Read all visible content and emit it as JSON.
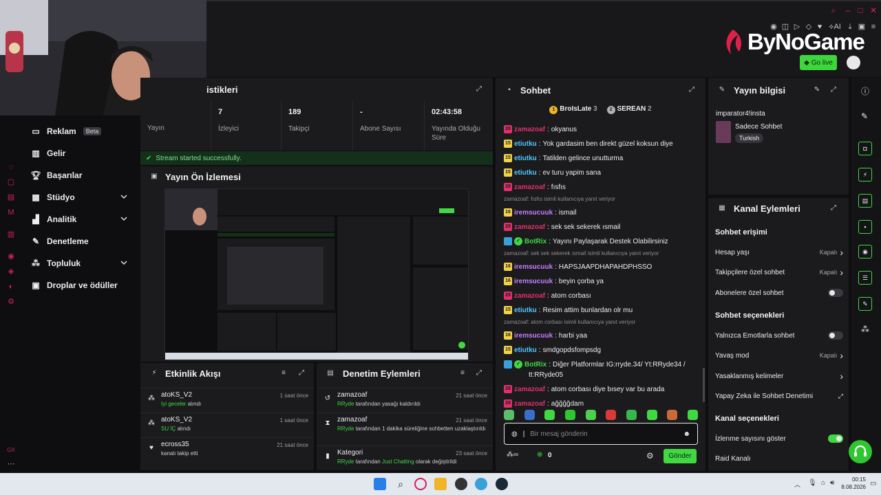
{
  "browser": {
    "brand": "ByNoGame",
    "go_live": "Go live",
    "tool_ai": "AI"
  },
  "sidebar": {
    "items": [
      {
        "label": "Reklam",
        "badge": "Beta"
      },
      {
        "label": "Gelir"
      },
      {
        "label": "Başarılar"
      },
      {
        "label": "Stüdyo"
      },
      {
        "label": "Analitik"
      },
      {
        "label": "Denetleme"
      },
      {
        "label": "Topluluk"
      },
      {
        "label": "Droplar ve ödüller"
      }
    ],
    "rail_text": "GX"
  },
  "stats": {
    "title_fragment": "istikleri",
    "cells": [
      {
        "value": "",
        "label": "Yayın"
      },
      {
        "value": "7",
        "label": "İzleyici"
      },
      {
        "value": "189",
        "label": "Takipçi"
      },
      {
        "value": "-",
        "label": "Abone Sayısı"
      },
      {
        "value": "02:43:58",
        "label": "Yayında Olduğu Süre"
      }
    ],
    "success_message": "Stream started successfully."
  },
  "preview": {
    "title": "Yayın Ön İzlemesi"
  },
  "events": {
    "title": "Etkinlik Akışı",
    "rows": [
      {
        "user": "atoKS_V2",
        "item": "Iyi geceler",
        "suffix": "alındı",
        "time": "1 saat önce"
      },
      {
        "user": "atoKS_V2",
        "item": "SU İÇ",
        "suffix": "alındı",
        "time": "1 saat önce"
      },
      {
        "user": "ecross35",
        "item": "",
        "suffix": "kanalı takip etti",
        "time": "21 saat önce"
      }
    ]
  },
  "moderation": {
    "title": "Denetim Eylemleri",
    "rows": [
      {
        "title": "zamazoaf",
        "by": "RRyde",
        "text": "tarafından yasağı kaldırıldı",
        "time": "21 saat önce"
      },
      {
        "title": "zamazoaf",
        "by": "RRyde",
        "text": "tarafından 1 dakika süreliğine sohbetten uzaklaştırıldı",
        "time": "21 saat önce"
      },
      {
        "title": "Kategori",
        "by": "RRyde",
        "text": "tarafından",
        "highlight": "Just Chatting",
        "tail": "olarak değiştirildi",
        "time": "23 saat önce"
      }
    ]
  },
  "chat": {
    "title": "Sohbet",
    "top": [
      {
        "rank": "1",
        "name": "BroIsLate",
        "count": "3"
      },
      {
        "rank": "2",
        "name": "SEREAN",
        "count": "2"
      }
    ],
    "messages": [
      {
        "type": "msg",
        "lvl": "28",
        "user": "zamazoaf",
        "color": "#e0306a",
        "text": "okyanus"
      },
      {
        "type": "msg",
        "lvl": "15",
        "user": "etiutku",
        "color": "#4ec8ff",
        "text": "Yok gardasim ben direkt güzel koksun diye"
      },
      {
        "type": "msg",
        "lvl": "15",
        "user": "etiutku",
        "color": "#4ec8ff",
        "text": "Tatilden gelince unutturma"
      },
      {
        "type": "msg",
        "lvl": "15",
        "user": "etiutku",
        "color": "#4ec8ff",
        "text": "ev turu yapim sana"
      },
      {
        "type": "msg",
        "lvl": "28",
        "user": "zamazoaf",
        "color": "#e0306a",
        "text": "fısfıs"
      },
      {
        "type": "reply",
        "text": "zamazoaf: fısfıs isimli kullanıcıya yanıt veriyor"
      },
      {
        "type": "msg",
        "lvl": "16",
        "user": "iremsucuuk",
        "color": "#c77dff",
        "text": "ismail"
      },
      {
        "type": "msg",
        "lvl": "28",
        "user": "zamazoaf",
        "color": "#e0306a",
        "text": "sek sek sekerek ısmail"
      },
      {
        "type": "msg",
        "lvl": "B",
        "user": "BotRix",
        "color": "#41d843",
        "text": "Yayını Paylaşarak Destek Olabilirsiniz"
      },
      {
        "type": "reply",
        "text": "zamazoaf: sek sek sekerek ısmail isimli kullanıcıya yanıt veriyor"
      },
      {
        "type": "msg",
        "lvl": "16",
        "user": "iremsucuuk",
        "color": "#c77dff",
        "text": "HAPSJAAPDHAPAHDPHSSO"
      },
      {
        "type": "msg",
        "lvl": "16",
        "user": "iremsucuuk",
        "color": "#c77dff",
        "text": "beyin çorba ya"
      },
      {
        "type": "msg",
        "lvl": "28",
        "user": "zamazoaf",
        "color": "#e0306a",
        "text": "atom corbası"
      },
      {
        "type": "msg",
        "lvl": "15",
        "user": "etiutku",
        "color": "#4ec8ff",
        "text": "Resim attim bunlardan olr mu"
      },
      {
        "type": "reply",
        "text": "zamazoaf: atom corbası isimli kullanıcıya yanıt veriyor"
      },
      {
        "type": "msg",
        "lvl": "16",
        "user": "iremsucuuk",
        "color": "#c77dff",
        "text": "harbi yaa"
      },
      {
        "type": "msg",
        "lvl": "15",
        "user": "etiutku",
        "color": "#4ec8ff",
        "text": "smdgopdsfompsdg"
      },
      {
        "type": "msg2",
        "lvl": "B",
        "user": "BotRix",
        "color": "#41d843",
        "text": "Diğer Platformlar IG:rryde.34/ Yt:RRyde34 /",
        "text2": "tt:RRyde05"
      },
      {
        "type": "msg",
        "lvl": "28",
        "user": "zamazoaf",
        "color": "#e0306a",
        "text": "atom corbası diye bısey var bu arada"
      },
      {
        "type": "msg",
        "lvl": "28",
        "user": "zamazoaf",
        "color": "#e0306a",
        "text": "ağğğğdam"
      }
    ],
    "input_placeholder": "Bir mesaj gönderin",
    "points": "0",
    "send": "Gönder"
  },
  "info": {
    "title": "Yayın bilgisi",
    "stream_title": "imparator4!insta",
    "category": "Sadece Sohbet",
    "language": "Turkish"
  },
  "channel": {
    "title": "Kanal Eylemleri",
    "chat_access": "Sohbet erişimi",
    "access_rows": [
      {
        "label": "Hesap yaşı",
        "state": "Kapalı",
        "kind": "chev"
      },
      {
        "label": "Takipçilere özel sohbet",
        "state": "Kapalı",
        "kind": "chev"
      },
      {
        "label": "Abonelere özel sohbet",
        "state": "",
        "kind": "toggle-off"
      }
    ],
    "chat_options": "Sohbet seçenekleri",
    "option_rows": [
      {
        "label": "Yalnızca Emotlarla sohbet",
        "state": "",
        "kind": "toggle-off"
      },
      {
        "label": "Yavaş mod",
        "state": "Kapalı",
        "kind": "chev"
      },
      {
        "label": "Yasaklanmış kelimeler",
        "state": "",
        "kind": "chev"
      },
      {
        "label": "Yapay Zeka ile Sohbet Denetimi",
        "state": "",
        "kind": "ext"
      }
    ],
    "channel_options": "Kanal seçenekleri",
    "channel_rows": [
      {
        "label": "İzlenme sayısını göster",
        "state": "",
        "kind": "toggle-on"
      },
      {
        "label": "Raid Kanalı",
        "state": "",
        "kind": "none"
      }
    ]
  },
  "taskbar": {
    "time": "00:15",
    "date": "8.08.2026"
  },
  "colors": {
    "accent": "#41d843",
    "bg": "#0e0e10",
    "panel": "#1b1b1e",
    "brand_red": "#e0204a"
  }
}
